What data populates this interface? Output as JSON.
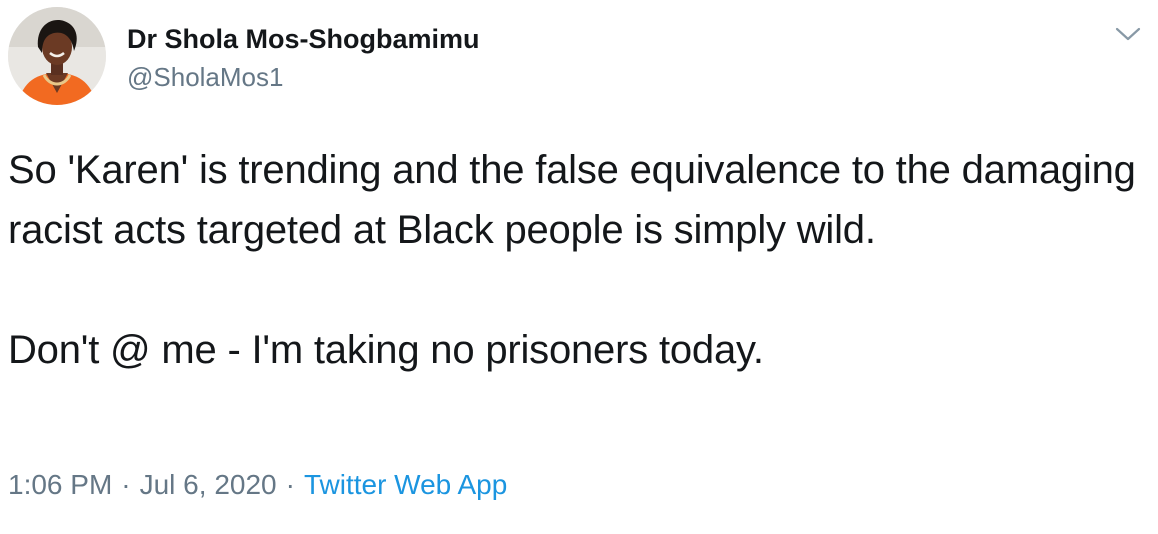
{
  "author": {
    "display_name": "Dr Shola Mos-Shogbamimu",
    "handle": "@SholaMos1",
    "avatar_icon": "profile-photo"
  },
  "tweet": {
    "paragraphs": [
      "So 'Karen' is trending and the false equivalence to the damaging racist acts targeted at Black people is simply wild.",
      "Don't @ me - I'm taking no prisoners today."
    ]
  },
  "meta": {
    "time": "1:06 PM",
    "date": "Jul 6, 2020",
    "separator": "·",
    "source": "Twitter Web App"
  },
  "colors": {
    "text": "#14171a",
    "secondary": "#657786",
    "link": "#1b95e0",
    "caret": "#8899a6"
  },
  "icons": {
    "menu": "chevron-down-icon"
  }
}
